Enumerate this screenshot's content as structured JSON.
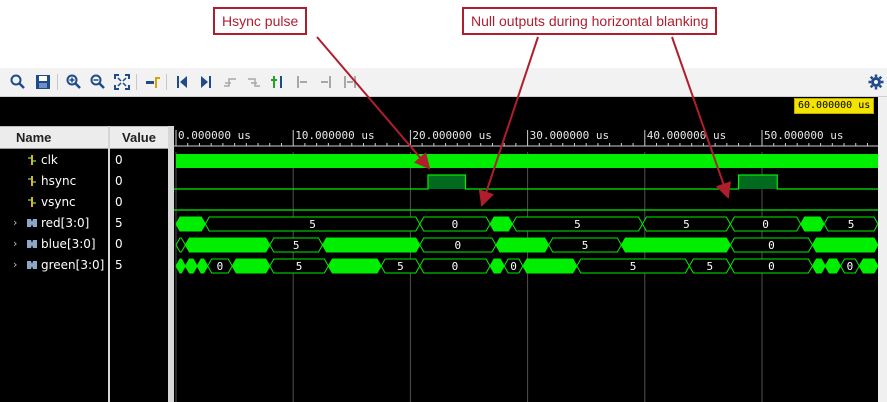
{
  "callouts": {
    "hsync_pulse": "Hsync pulse",
    "null_outputs": "Null outputs during horizontal blanking"
  },
  "toolbar": {
    "buttons": [
      "search-icon",
      "save-icon",
      "zoom-in-icon",
      "zoom-out-icon",
      "zoom-fit-icon",
      "go-to-cursor-icon",
      "go-to-time-0-icon",
      "go-to-last-time-icon",
      "previous-transition-icon",
      "next-transition-icon",
      "add-marker-icon",
      "previous-marker-icon",
      "next-marker-icon",
      "swap-cursors-icon",
      "settings-icon"
    ]
  },
  "header": {
    "name_label": "Name",
    "value_label": "Value"
  },
  "cursor": {
    "time_label": "60.000000 us"
  },
  "timeline": {
    "ticks": [
      "0.000000 us",
      "10.000000 us",
      "20.000000 us",
      "30.000000 us",
      "40.000000 us",
      "50.000000 us"
    ],
    "units_per_tick": 10,
    "unit": "us"
  },
  "signals": [
    {
      "name": "clk",
      "value": "0",
      "bus": false
    },
    {
      "name": "hsync",
      "value": "0",
      "bus": false
    },
    {
      "name": "vsync",
      "value": "0",
      "bus": false
    },
    {
      "name": "red[3:0]",
      "value": "5",
      "bus": true
    },
    {
      "name": "blue[3:0]",
      "value": "0",
      "bus": true
    },
    {
      "name": "green[3:0]",
      "value": "5",
      "bus": true
    }
  ],
  "waves": {
    "hsync_high_us": [
      [
        21.5,
        24.7
      ],
      [
        48.0,
        51.3
      ]
    ],
    "red": [
      {
        "start": 0.0,
        "end": 2.5,
        "label": ""
      },
      {
        "start": 2.5,
        "end": 20.8,
        "label": "5"
      },
      {
        "start": 20.8,
        "end": 26.8,
        "label": "0"
      },
      {
        "start": 26.8,
        "end": 28.7,
        "label": ""
      },
      {
        "start": 28.7,
        "end": 39.8,
        "label": "5"
      },
      {
        "start": 39.8,
        "end": 47.3,
        "label": "5"
      },
      {
        "start": 47.3,
        "end": 53.3,
        "label": "0"
      },
      {
        "start": 53.3,
        "end": 55.3,
        "label": ""
      },
      {
        "start": 55.3,
        "end": 60.0,
        "label": "5"
      }
    ],
    "blue": [
      {
        "start": 0.0,
        "end": 0.8,
        "label": "5"
      },
      {
        "start": 0.8,
        "end": 8.0,
        "label": ""
      },
      {
        "start": 8.0,
        "end": 12.5,
        "label": "5"
      },
      {
        "start": 12.5,
        "end": 20.8,
        "label": ""
      },
      {
        "start": 20.8,
        "end": 27.3,
        "label": "0"
      },
      {
        "start": 27.3,
        "end": 31.8,
        "label": ""
      },
      {
        "start": 31.8,
        "end": 38.0,
        "label": "5"
      },
      {
        "start": 38.0,
        "end": 47.3,
        "label": ""
      },
      {
        "start": 47.3,
        "end": 54.3,
        "label": "0"
      },
      {
        "start": 54.3,
        "end": 60.0,
        "label": ""
      }
    ],
    "green": [
      {
        "start": 0.0,
        "end": 0.8,
        "label": ""
      },
      {
        "start": 0.8,
        "end": 1.8,
        "label": ""
      },
      {
        "start": 1.8,
        "end": 2.7,
        "label": ""
      },
      {
        "start": 2.7,
        "end": 4.8,
        "label": "0"
      },
      {
        "start": 4.8,
        "end": 8.0,
        "label": ""
      },
      {
        "start": 8.0,
        "end": 13.0,
        "label": "5"
      },
      {
        "start": 13.0,
        "end": 17.5,
        "label": ""
      },
      {
        "start": 17.5,
        "end": 20.8,
        "label": "5"
      },
      {
        "start": 20.8,
        "end": 26.8,
        "label": "0"
      },
      {
        "start": 26.8,
        "end": 28.0,
        "label": ""
      },
      {
        "start": 28.0,
        "end": 29.6,
        "label": "0"
      },
      {
        "start": 29.6,
        "end": 34.2,
        "label": ""
      },
      {
        "start": 34.2,
        "end": 43.8,
        "label": "5"
      },
      {
        "start": 43.8,
        "end": 47.3,
        "label": "5"
      },
      {
        "start": 47.3,
        "end": 54.3,
        "label": "0"
      },
      {
        "start": 54.3,
        "end": 55.4,
        "label": ""
      },
      {
        "start": 55.4,
        "end": 56.7,
        "label": ""
      },
      {
        "start": 56.7,
        "end": 58.3,
        "label": "0"
      },
      {
        "start": 58.3,
        "end": 60.0,
        "label": ""
      }
    ]
  },
  "colors": {
    "wave_green": "#00ee00",
    "pulse_fill": "#006b1e",
    "bus_fill": "#00ee00",
    "bus_outline": "#00ee00",
    "callout_red": "#b01e2e",
    "cursor_yellow": "#f3e300"
  }
}
